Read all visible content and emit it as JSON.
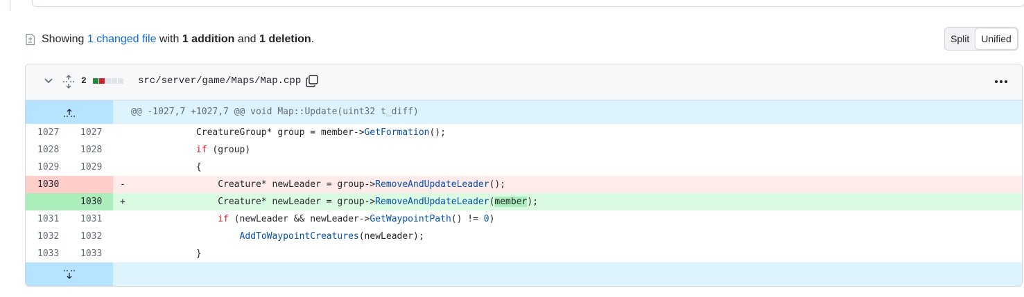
{
  "summary": {
    "showing": "Showing",
    "changed_files": "1 changed file",
    "with": "with",
    "additions": "1 addition",
    "and": "and",
    "deletions": "1 deletion",
    "period": "."
  },
  "view_toggle": {
    "split_label": "Split",
    "unified_label": "Unified",
    "selected": "Unified"
  },
  "file": {
    "change_count": "2",
    "diffstat": [
      "add",
      "del",
      "neutral",
      "neutral",
      "neutral"
    ],
    "path": "src/server/game/Maps/Map.cpp",
    "icons": [
      "chevron-down-icon",
      "unfold-icon",
      "copy-icon",
      "kebab-horizontal-icon",
      "fold-up-icon",
      "fold-down-icon"
    ]
  },
  "hunk": {
    "header": "@@ -1027,7 +1027,7 @@ void Map::Update(uint32 t_diff)"
  },
  "lines": [
    {
      "old": "1027",
      "new": "1027",
      "type": "ctx",
      "marker": "",
      "code": "            CreatureGroup* group = member->GetFormation();"
    },
    {
      "old": "1028",
      "new": "1028",
      "type": "ctx",
      "marker": "",
      "code": "            if (group)"
    },
    {
      "old": "1029",
      "new": "1029",
      "type": "ctx",
      "marker": "",
      "code": "            {"
    },
    {
      "old": "1030",
      "new": "",
      "type": "del",
      "marker": "-",
      "code": "                Creature* newLeader = group->RemoveAndUpdateLeader();"
    },
    {
      "old": "",
      "new": "1030",
      "type": "add",
      "marker": "+",
      "code": "                Creature* newLeader = group->RemoveAndUpdateLeader(member);"
    },
    {
      "old": "1031",
      "new": "1031",
      "type": "ctx",
      "marker": "",
      "code": "                if (newLeader && newLeader->GetWaypointPath() != 0)"
    },
    {
      "old": "1032",
      "new": "1032",
      "type": "ctx",
      "marker": "",
      "code": "                    AddToWaypointCreatures(newLeader);"
    },
    {
      "old": "1033",
      "new": "1033",
      "type": "ctx",
      "marker": "",
      "code": "            }"
    }
  ],
  "colors": {
    "link": "#0969da",
    "add_bg": "#dafbe1",
    "add_gutter": "#aceebb",
    "del_bg": "#ffebe9",
    "del_gutter": "#ffcecb",
    "hunk_bg": "#ddf4ff",
    "hunk_gutter": "#b6e3ff"
  }
}
